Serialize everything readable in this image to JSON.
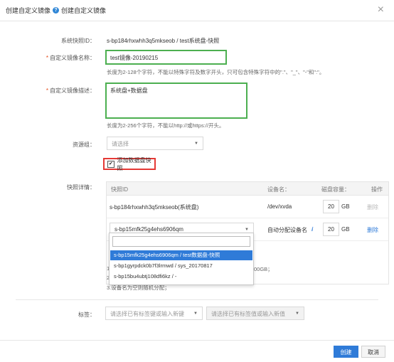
{
  "dialog": {
    "title": "创建自定义镜像",
    "help_label": "?",
    "help_link": "创建自定义镜像",
    "close_glyph": "×"
  },
  "snapshot": {
    "label": "系统快照ID：",
    "value": "s-bp184rhxwhh3q5mkseob /  test系统盘-快照"
  },
  "image_name": {
    "label": "自定义镜像名称：",
    "value": "test镜像-20190215",
    "hint": "长度为2-128个字符，不能以特殊字符及数字开头，只可包含特殊字符中的\".\"、\"_\"、\"-\"和\":\"。"
  },
  "image_desc": {
    "label": "自定义镜像描述：",
    "value": "系统盘+数据盘",
    "hint": "长度为2-256个字符，不能以http://或https://开头。"
  },
  "resource_group": {
    "label": "资源组：",
    "placeholder": "请选择"
  },
  "add_data_disk": {
    "label": "添加数据盘快照",
    "checked": true,
    "check_glyph": "✔"
  },
  "snapshot_details": {
    "label": "快照详情：",
    "columns": [
      "快照ID",
      "设备名：",
      "磁盘容量：",
      "操作"
    ],
    "rows": [
      {
        "id": "s-bp184rhxwhh3q5mkseob(系统盘)",
        "device": "/dev/xvda",
        "capacity": "20",
        "unit": "GB",
        "action": "删除"
      },
      {
        "id": "s-bp15mfk25g4ehs6906qm",
        "device": "自动分配设备名",
        "info": "i",
        "capacity": "20",
        "unit": "GB",
        "action": "删除"
      }
    ]
  },
  "dropdown": {
    "options": [
      "s-bp15mfk25g4ehs6906qm / test数据盘-快照",
      "s-bp1gyrpdck0b7f3lrmwd / sys_20170817",
      "s-bp15bu4ubtj108dfi6kz / -"
    ],
    "selected_index": 0
  },
  "notes": {
    "line1_partial": "1",
    "line1_tail": "00GB；",
    "line2_partial": "2",
    "line3": "3.设备名为空则随机分配；"
  },
  "tags": {
    "label": "标签：",
    "key_placeholder": "请选择已有标签键或输入新键",
    "value_placeholder": "请选择已有标签值或输入新值"
  },
  "footer": {
    "create": "创建",
    "cancel": "取消"
  },
  "colors": {
    "primary": "#2f7bd8",
    "highlight_border": "#e53935",
    "annotation_border": "#4caf50"
  },
  "icons": {
    "caret": "▼"
  }
}
